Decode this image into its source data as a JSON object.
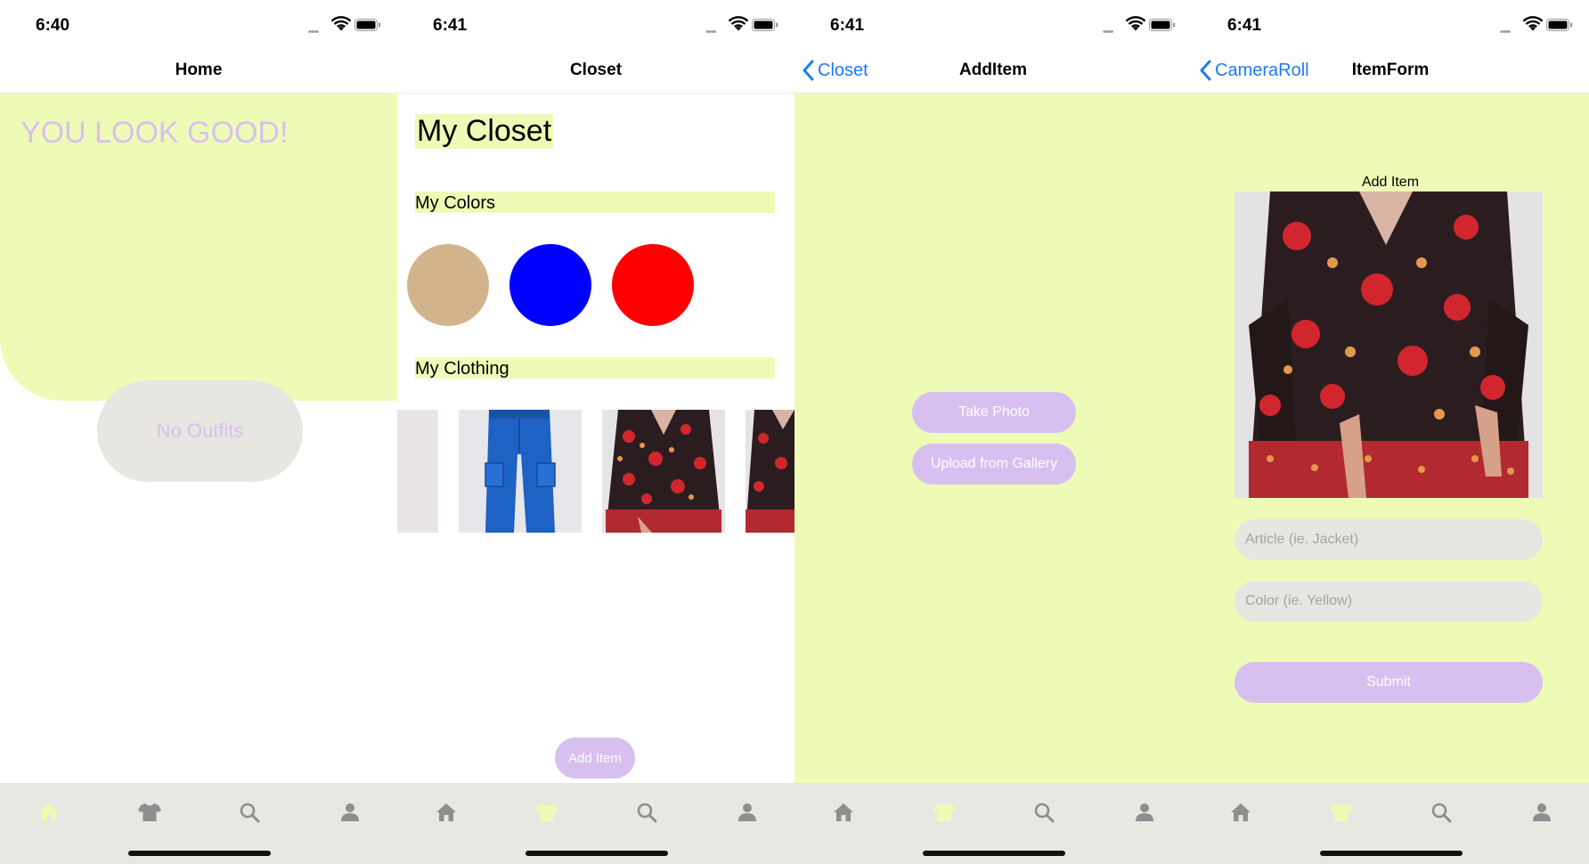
{
  "colors": {
    "accent_yellow": "#eefbb6",
    "accent_lavender": "#d7c0f0",
    "neutral_grey": "#e7e6e1",
    "ios_blue": "#1a7cf5",
    "tab_inactive": "#8e8e8e"
  },
  "tabs": [
    "home-icon",
    "shirt-icon",
    "search-icon",
    "person-icon"
  ],
  "home_screen": {
    "time": "6:40",
    "nav_title": "Home",
    "headline": "YOU LOOK GOOD!",
    "no_outfits_label": "No Outfits",
    "active_tab": "home"
  },
  "closet_screen": {
    "time": "6:41",
    "nav_title": "Closet",
    "page_title": "My Closet",
    "colors_label": "My Colors",
    "color_swatches": [
      "#d2b48c",
      "#0000ff",
      "#ff0000"
    ],
    "clothing_label": "My Clothing",
    "clothing_items": [
      "partial-item",
      "blue-cargo-pants",
      "floral-dress",
      "floral-dress"
    ],
    "add_item_label": "Add Item",
    "active_tab": "closet"
  },
  "add_item_screen": {
    "time": "6:41",
    "back_label": "Closet",
    "nav_title": "AddItem",
    "take_photo_label": "Take Photo",
    "upload_label": "Upload from Gallery",
    "active_tab": "closet"
  },
  "item_form_screen": {
    "time": "6:41",
    "back_label": "CameraRoll",
    "nav_title": "ItemForm",
    "heading": "Add Item",
    "article_placeholder": "Article (ie. Jacket)",
    "color_placeholder": "Color (ie. Yellow)",
    "submit_label": "Submit",
    "active_tab": "closet"
  }
}
